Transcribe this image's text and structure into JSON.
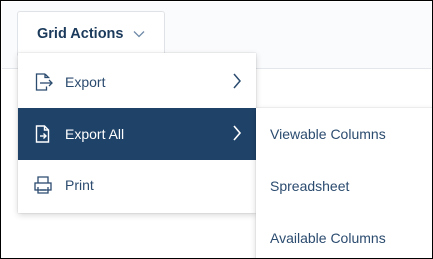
{
  "toolbar": {
    "grid_actions_label": "Grid Actions"
  },
  "menu": {
    "items": [
      {
        "label": "Export",
        "icon": "export-icon"
      },
      {
        "label": "Export All",
        "icon": "export-all-icon"
      },
      {
        "label": "Print",
        "icon": "printer-icon"
      }
    ]
  },
  "submenu": {
    "items": [
      {
        "label": "Viewable Columns"
      },
      {
        "label": "Spreadsheet"
      },
      {
        "label": "Available Columns"
      }
    ]
  },
  "colors": {
    "accent": "#1f4268",
    "text": "#2b4b6f",
    "button_text": "#1b3a5b"
  }
}
